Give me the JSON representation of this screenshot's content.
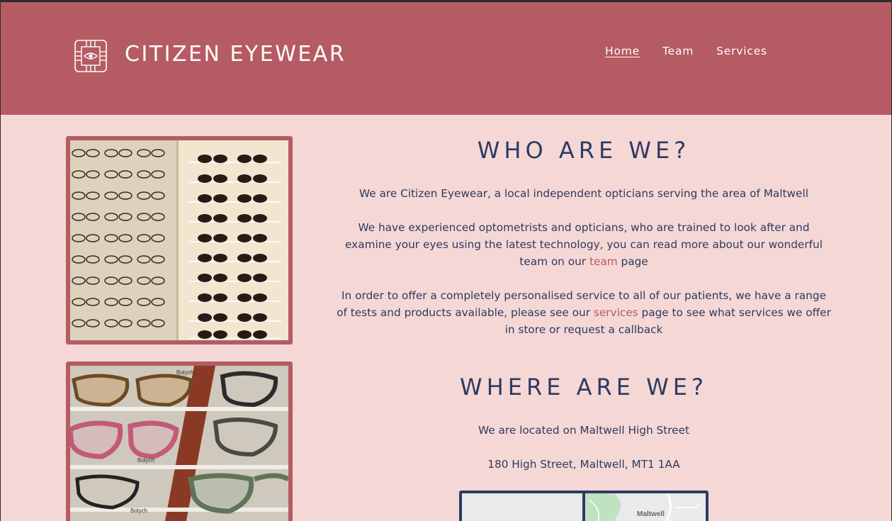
{
  "brand": {
    "name": "CITIZEN EYEWEAR",
    "logo_icon": "eye-compass-icon"
  },
  "nav": {
    "items": [
      {
        "label": "Home",
        "active": true
      },
      {
        "label": "Team",
        "active": false
      },
      {
        "label": "Services",
        "active": false
      }
    ]
  },
  "colors": {
    "header": "#b55b63",
    "page_background": "#f5d8d5",
    "text": "#2e3a63",
    "link": "#b55b63"
  },
  "who": {
    "title": "WHO ARE WE?",
    "p1": "We are Citizen Eyewear, a local independent opticians serving the area of Maltwell",
    "p2_before": "We have experienced optometrists and opticians, who are trained to look after and examine your eyes using the latest technology, you can read more about our wonderful team on our ",
    "p2_link": "team",
    "p2_after": " page",
    "p3_before": "In order to offer a completely personalised service to all of our patients, we have a range of tests and products available, please see our ",
    "p3_link": "services",
    "p3_after": " page to see what services we offer in store or request a callback"
  },
  "where": {
    "title": "WHERE ARE WE?",
    "p1": "We are located on Maltwell High Street",
    "address": "180 High Street, Maltwell, MT1 1AA",
    "map_label": "Maltwell"
  }
}
